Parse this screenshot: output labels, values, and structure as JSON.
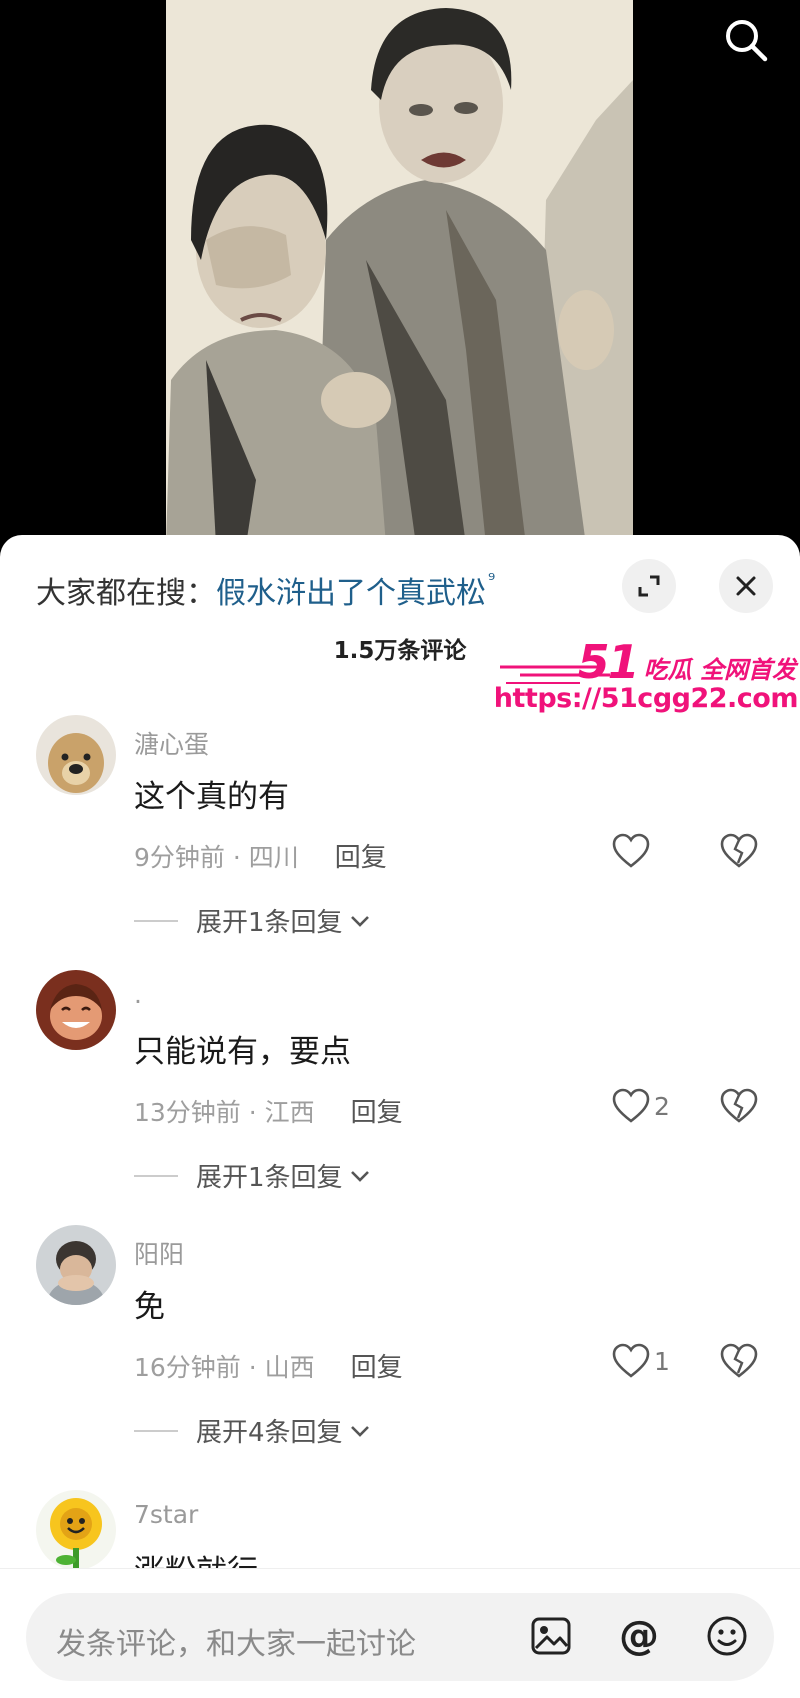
{
  "video": {
    "search_icon": "search-icon"
  },
  "sheet": {
    "search_prefix": "大家都在搜：",
    "search_term": "假水浒出了个真武松",
    "search_term_icon": "⁹",
    "expand_icon": "expand-icon",
    "close_icon": "close-icon",
    "comment_count": "1.5万条评论"
  },
  "watermark": {
    "line1_num": "51",
    "line1_text": "吃瓜 全网首发",
    "url": "https://51cgg22.com",
    "color": "#f0127a"
  },
  "comments": [
    {
      "username": "溏心蛋",
      "text": "这个真的有",
      "meta": "9分钟前 · 四川",
      "reply": "回复",
      "likes": "",
      "expand": "展开1条回复"
    },
    {
      "username": ".",
      "text": "只能说有，要点",
      "meta": "13分钟前 · 江西",
      "reply": "回复",
      "likes": "2",
      "expand": "展开1条回复"
    },
    {
      "username": "阳阳",
      "text": "免",
      "meta": "16分钟前 · 山西",
      "reply": "回复",
      "likes": "1",
      "expand": "展开4条回复"
    },
    {
      "username": "7star",
      "text": "涨粉就行"
    }
  ],
  "bottom_bar": {
    "placeholder": "发条评论，和大家一起讨论",
    "mention_symbol": "@",
    "icons": [
      "image-icon",
      "at-icon",
      "emoji-icon"
    ]
  },
  "colors": {
    "link": "#1f5f8b",
    "watermark": "#f0127a",
    "sheet_bg": "#ffffff"
  }
}
